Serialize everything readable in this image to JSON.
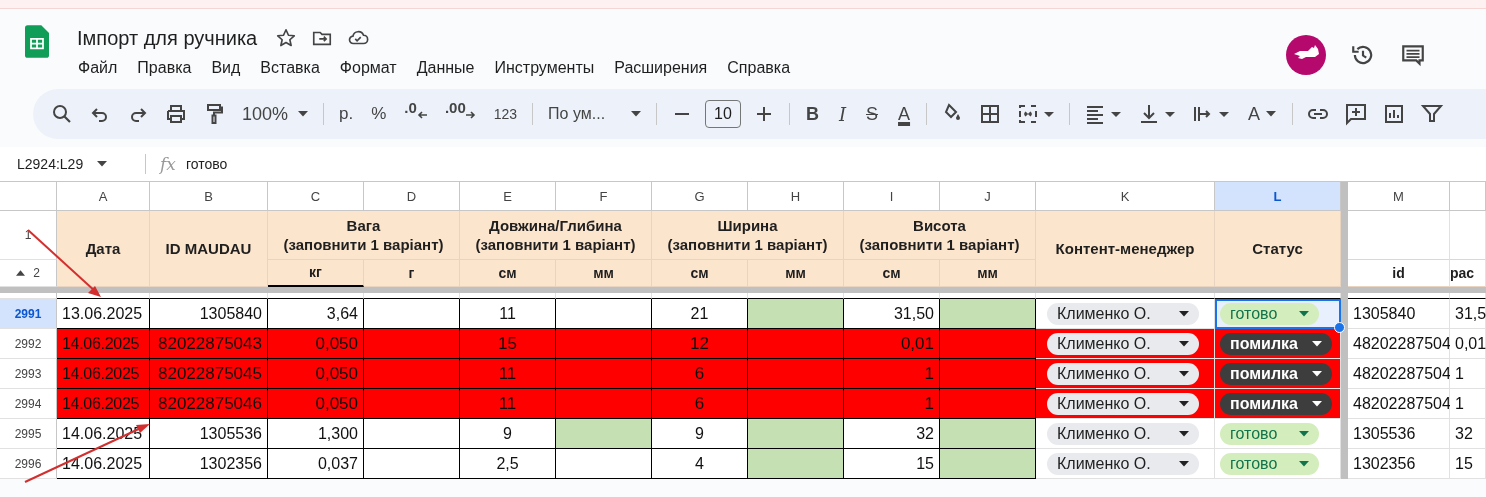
{
  "title": "Імпорт для ручника",
  "menu": [
    "Файл",
    "Правка",
    "Вид",
    "Вставка",
    "Формат",
    "Данные",
    "Инструменты",
    "Расширения",
    "Справка"
  ],
  "toolbar": {
    "zoom": "100%",
    "currency": "р.",
    "percent": "%",
    "decimal_decrease": ".0",
    "decimal_increase": ".00",
    "number_format": "123",
    "font": "По ум...",
    "font_size": "10",
    "bold": "B",
    "italic": "I",
    "strikethrough": "S",
    "text_color": "A",
    "text_rotation": "A"
  },
  "name_box": "L2924:L29",
  "function_label": "fx",
  "formula": "готово",
  "columns": [
    {
      "letter": "A",
      "selected": false
    },
    {
      "letter": "B",
      "selected": false
    },
    {
      "letter": "C",
      "selected": false
    },
    {
      "letter": "D",
      "selected": false
    },
    {
      "letter": "E",
      "selected": false
    },
    {
      "letter": "F",
      "selected": false
    },
    {
      "letter": "G",
      "selected": false
    },
    {
      "letter": "H",
      "selected": false
    },
    {
      "letter": "I",
      "selected": false
    },
    {
      "letter": "J",
      "selected": false
    },
    {
      "letter": "K",
      "selected": false
    },
    {
      "letter": "L",
      "selected": true
    },
    {
      "letter": "M",
      "selected": false
    }
  ],
  "header_rows": [
    "1",
    "2"
  ],
  "headers": [
    {
      "label": "Дата"
    },
    {
      "label": "ID MAUDAU"
    },
    {
      "label": "Вага\n(заповнити 1 варіант)",
      "units": [
        "кг",
        "г"
      ]
    },
    {
      "label": "Довжина/Глибина\n(заповнити 1 варіант)",
      "units": [
        "см",
        "мм"
      ]
    },
    {
      "label": "Ширина\n(заповнити 1 варіант)",
      "units": [
        "см",
        "мм"
      ]
    },
    {
      "label": "Висота\n(заповнити 1 варіант)",
      "units": [
        "см",
        "мм"
      ]
    },
    {
      "label": "Контент-менеджер"
    },
    {
      "label": "Статус"
    }
  ],
  "extra_headers": [
    "id",
    "pac"
  ],
  "rows": [
    {
      "number": "2991",
      "selected": true,
      "error": false,
      "cells": [
        {
          "text": "13.06.2025",
          "filled": false
        },
        {
          "text": "1305840",
          "filled": false
        },
        {
          "text": "3,64",
          "filled": false
        },
        {
          "filled": false
        },
        {
          "text": "11",
          "filled": false
        },
        {
          "filled": false
        },
        {
          "text": "21",
          "filled": false
        },
        {
          "filled": true
        },
        {
          "text": "31,50",
          "filled": false
        },
        {
          "filled": true
        }
      ],
      "manager": "Клименко О.",
      "status": {
        "text": "готово",
        "kind": "done",
        "selected": true
      },
      "id": "1305840",
      "pack": "31,5"
    },
    {
      "number": "2992",
      "selected": false,
      "error": true,
      "cells": [
        {
          "text": "14.06.2025",
          "filled": false
        },
        {
          "text": "82022875043",
          "filled": false
        },
        {
          "text": "0,050",
          "filled": false
        },
        {
          "filled": false
        },
        {
          "text": "15",
          "filled": false
        },
        {
          "filled": false
        },
        {
          "text": "12",
          "filled": false
        },
        {
          "filled": false
        },
        {
          "text": "0,01",
          "filled": false
        },
        {
          "filled": false
        }
      ],
      "manager": "Клименко О.",
      "status": {
        "text": "помилка",
        "kind": "error",
        "selected": false
      },
      "id": "48202287504",
      "pack": "0,01"
    },
    {
      "number": "2993",
      "selected": false,
      "error": true,
      "cells": [
        {
          "text": "14.06.2025",
          "filled": false
        },
        {
          "text": "82022875045",
          "filled": false
        },
        {
          "text": "0,050",
          "filled": false
        },
        {
          "filled": false
        },
        {
          "text": "11",
          "filled": false
        },
        {
          "filled": false
        },
        {
          "text": "6",
          "filled": false
        },
        {
          "filled": false
        },
        {
          "text": "1",
          "filled": false
        },
        {
          "filled": false
        }
      ],
      "manager": "Клименко О.",
      "status": {
        "text": "помилка",
        "kind": "error",
        "selected": false
      },
      "id": "48202287504",
      "pack": "1"
    },
    {
      "number": "2994",
      "selected": false,
      "error": true,
      "cells": [
        {
          "text": "14.06.2025",
          "filled": false
        },
        {
          "text": "82022875046",
          "filled": false
        },
        {
          "text": "0,050",
          "filled": false
        },
        {
          "filled": false
        },
        {
          "text": "11",
          "filled": false
        },
        {
          "filled": false
        },
        {
          "text": "6",
          "filled": false
        },
        {
          "filled": false
        },
        {
          "text": "1",
          "filled": false
        },
        {
          "filled": false
        }
      ],
      "manager": "Клименко О.",
      "status": {
        "text": "помилка",
        "kind": "error",
        "selected": false
      },
      "id": "48202287504",
      "pack": "1"
    },
    {
      "number": "2995",
      "selected": false,
      "error": false,
      "cells": [
        {
          "text": "14.06.2025",
          "filled": false
        },
        {
          "text": "1305536",
          "filled": false
        },
        {
          "text": "1,300",
          "filled": false
        },
        {
          "filled": false
        },
        {
          "text": "9",
          "filled": false
        },
        {
          "filled": true
        },
        {
          "text": "9",
          "filled": false
        },
        {
          "filled": true
        },
        {
          "text": "32",
          "filled": false
        },
        {
          "filled": true
        }
      ],
      "manager": "Клименко О.",
      "status": {
        "text": "готово",
        "kind": "done",
        "selected": false
      },
      "id": "1305536",
      "pack": "32"
    },
    {
      "number": "2996",
      "selected": false,
      "error": false,
      "cells": [
        {
          "text": "14.06.2025",
          "filled": false
        },
        {
          "text": "1302356",
          "filled": false
        },
        {
          "text": "0,037",
          "filled": false
        },
        {
          "filled": false
        },
        {
          "text": "2,5",
          "filled": false
        },
        {
          "filled": false
        },
        {
          "text": "4",
          "filled": false
        },
        {
          "filled": true
        },
        {
          "text": "15",
          "filled": false
        },
        {
          "filled": true
        }
      ],
      "manager": "Клименко О.",
      "status": {
        "text": "готово",
        "kind": "done",
        "selected": false
      },
      "id": "1302356",
      "pack": "15"
    }
  ]
}
